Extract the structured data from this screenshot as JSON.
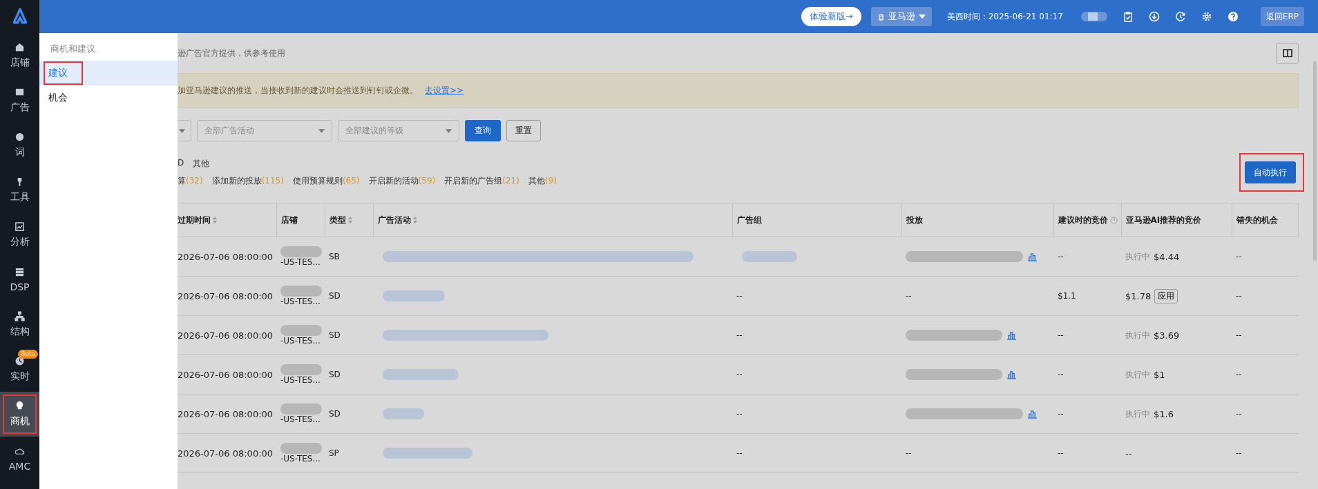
{
  "sidebar": {
    "items": [
      {
        "label": "店铺",
        "selected": false,
        "highlighted": false
      },
      {
        "label": "广告",
        "selected": false,
        "highlighted": false
      },
      {
        "label": "词",
        "selected": false,
        "highlighted": false
      },
      {
        "label": "工具",
        "selected": false,
        "highlighted": false
      },
      {
        "label": "分析",
        "selected": false,
        "highlighted": false
      },
      {
        "label": "DSP",
        "selected": false,
        "highlighted": false
      },
      {
        "label": "结构",
        "selected": false,
        "highlighted": false
      },
      {
        "label": "实时",
        "badge": "Beta",
        "selected": false,
        "highlighted": false
      },
      {
        "label": "商机",
        "selected": true,
        "highlighted": true
      },
      {
        "label": "AMC",
        "selected": false,
        "highlighted": false
      }
    ]
  },
  "topbar": {
    "new_version": "体验新版→",
    "marketplace": "亚马逊",
    "time": "美西时间：2025-06-21 01:17",
    "back": "返回ERP",
    "toggle": {
      "on": false
    }
  },
  "submenu": {
    "title": "商机和建议",
    "items": [
      {
        "label": "建议",
        "selected": true,
        "highlighted": true
      },
      {
        "label": "机会",
        "selected": false,
        "highlighted": false
      }
    ]
  },
  "subtitle": "逊广告官方提供，供参考使用",
  "notice": {
    "text": "加亚马逊建议的推送，当接收到新的建议时会推送到钉钉或企微。",
    "link": "去设置>>"
  },
  "filters": {
    "campaign": "全部广告活动",
    "level": "全部建议的等级",
    "query": "查询",
    "reset": "重置"
  },
  "type_tabs": [
    "D",
    "其他"
  ],
  "category_tabs": [
    {
      "label": "算",
      "count": "(32)"
    },
    {
      "label": "添加新的投放",
      "count": "(115)"
    },
    {
      "label": "使用预算规则",
      "count": "(65)"
    },
    {
      "label": "开启新的活动",
      "count": "(59)"
    },
    {
      "label": "开启新的广告组",
      "count": "(21)"
    },
    {
      "label": "其他",
      "count": "(9)"
    }
  ],
  "auto_button": {
    "label": "自动执行",
    "highlighted": true
  },
  "table": {
    "columns": [
      "过期时间",
      "店铺",
      "类型",
      "广告活动",
      "广告组",
      "投放",
      "建议时的竞价",
      "亚马逊AI推荐的竞价",
      "错失的机会"
    ],
    "rows": [
      {
        "expires": "2026-07-06 08:00:00",
        "store": "-US-TES...",
        "type": "SB",
        "ad_group_blurred": true,
        "target_blurred": true,
        "target_chart": true,
        "bid": "--",
        "ai_status": "执行中",
        "ai_bid": "$4.44",
        "missed": "--"
      },
      {
        "expires": "2026-07-06 08:00:00",
        "store": "-US-TES...",
        "type": "SD",
        "ad_group_blurred": false,
        "ad_group": "--",
        "target_blurred": false,
        "target": "--",
        "target_chart": false,
        "bid": "$1.1",
        "ai_bid": "$1.78",
        "ai_action": "应用",
        "missed": "--"
      },
      {
        "expires": "2026-07-06 08:00:00",
        "store": "-US-TES...",
        "type": "SD",
        "ad_group_blurred": false,
        "ad_group": "--",
        "target_blurred": true,
        "target_chart": true,
        "bid": "--",
        "ai_status": "执行中",
        "ai_bid": "$3.69",
        "missed": "--"
      },
      {
        "expires": "2026-07-06 08:00:00",
        "store": "-US-TES...",
        "type": "SD",
        "ad_group_blurred": false,
        "ad_group": "--",
        "target_blurred": true,
        "target_chart": true,
        "bid": "--",
        "ai_status": "执行中",
        "ai_bid": "$1",
        "missed": "--"
      },
      {
        "expires": "2026-07-06 08:00:00",
        "store": "-US-TES...",
        "type": "SD",
        "ad_group_blurred": false,
        "ad_group": "--",
        "target_blurred": true,
        "target_chart": true,
        "bid": "--",
        "ai_status": "执行中",
        "ai_bid": "$1.6",
        "missed": "--"
      },
      {
        "expires": "2026-07-06 08:00:00",
        "store": "-US-TES...",
        "type": "SP",
        "ad_group_blurred": false,
        "ad_group": "--",
        "target_blurred": false,
        "target": "--",
        "target_chart": false,
        "bid": "--",
        "ai_bid": "--",
        "missed": "--"
      }
    ]
  }
}
